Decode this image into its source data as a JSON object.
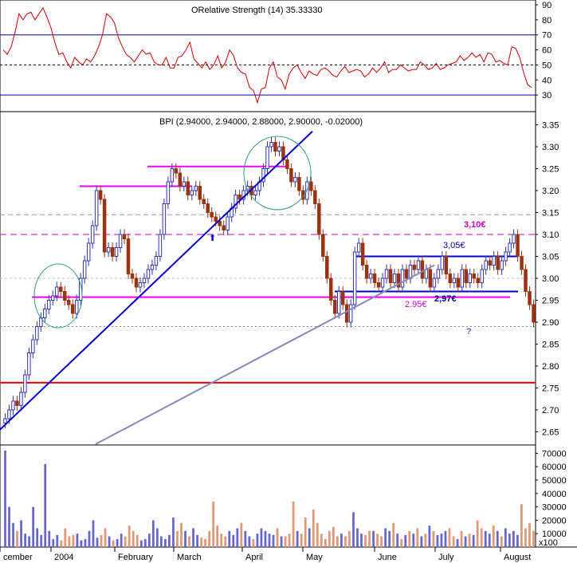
{
  "chart_data": [
    {
      "panel": "rsi",
      "type": "line",
      "title": "ORelative Strength (14) 35.33330",
      "ylim": [
        20,
        90
      ],
      "y_ticks": [
        90,
        80,
        70,
        60,
        50,
        40,
        30
      ],
      "reference_lines": [
        70,
        50,
        30
      ],
      "color": "#cc0000",
      "values": [
        60,
        57,
        62,
        72,
        84,
        80,
        84,
        85,
        80,
        84,
        88,
        82,
        75,
        65,
        57,
        58,
        52,
        48,
        55,
        52,
        50,
        54,
        52,
        56,
        62,
        70,
        84,
        82,
        78,
        68,
        62,
        57,
        55,
        52,
        56,
        60,
        57,
        58,
        52,
        50,
        50,
        55,
        48,
        48,
        55,
        56,
        60,
        65,
        54,
        51,
        48,
        52,
        47,
        50,
        56,
        48,
        52,
        60,
        56,
        48,
        45,
        44,
        35,
        33,
        25,
        34,
        35,
        48,
        52,
        42,
        40,
        34,
        44,
        48,
        50,
        45,
        41,
        46,
        44,
        43,
        47,
        48,
        46,
        43,
        42,
        46,
        49,
        45,
        46,
        47,
        46,
        42,
        44,
        48,
        45,
        48,
        52,
        45,
        47,
        47,
        50,
        48,
        46,
        47,
        47,
        52,
        50,
        47,
        48,
        51,
        47,
        48,
        50,
        51,
        52,
        56,
        53,
        55,
        58,
        55,
        57,
        52,
        58,
        57,
        52,
        53,
        51,
        50,
        62,
        61,
        55,
        45,
        37,
        35
      ]
    },
    {
      "panel": "price",
      "type": "ohlc",
      "title": "BPI (2.94000, 2.94000, 2.88000, 2.90000, -0.02000)",
      "ylim": [
        2.62,
        3.38
      ],
      "y_ticks": [
        "3.35",
        "3.30",
        "3.25",
        "3.20",
        "3.15",
        "3.10",
        "3.05",
        "3.00",
        "2.95",
        "2.90",
        "2.85",
        "2.80",
        "2.75",
        "2.70",
        "2.65"
      ],
      "x_labels": [
        "cember",
        "2004",
        "February",
        "March",
        "April",
        "May",
        "June",
        "July",
        "August"
      ],
      "up_color": "#3333aa",
      "down_color": "#993311",
      "close": [
        2.68,
        2.7,
        2.72,
        2.71,
        2.74,
        2.78,
        2.83,
        2.86,
        2.89,
        2.91,
        2.93,
        2.95,
        2.96,
        2.98,
        2.97,
        2.95,
        2.94,
        2.92,
        2.95,
        3.0,
        3.04,
        3.08,
        3.12,
        3.2,
        3.18,
        3.06,
        3.07,
        3.05,
        3.07,
        3.1,
        3.09,
        3.01,
        3.0,
        2.98,
        2.99,
        3.0,
        3.02,
        3.03,
        3.05,
        3.1,
        3.17,
        3.22,
        3.25,
        3.24,
        3.21,
        3.22,
        3.19,
        3.2,
        3.21,
        3.18,
        3.17,
        3.15,
        3.14,
        3.13,
        3.12,
        3.11,
        3.14,
        3.16,
        3.19,
        3.18,
        3.2,
        3.21,
        3.19,
        3.2,
        3.22,
        3.25,
        3.3,
        3.31,
        3.29,
        3.3,
        3.27,
        3.25,
        3.22,
        3.23,
        3.2,
        3.18,
        3.22,
        3.2,
        3.17,
        3.1,
        3.05,
        3.0,
        2.95,
        2.92,
        2.97,
        2.94,
        2.9,
        2.94,
        3.06,
        3.08,
        3.03,
        3.0,
        3.01,
        2.99,
        2.98,
        3.0,
        3.02,
        2.99,
        3.01,
        2.98,
        3.02,
        3.0,
        3.03,
        3.02,
        3.04,
        3.0,
        3.02,
        2.98,
        3.0,
        3.02,
        3.05,
        3.01,
        2.99,
        3.0,
        2.98,
        3.02,
        2.99,
        3.01,
        3.0,
        2.99,
        3.02,
        3.04,
        3.03,
        3.05,
        3.02,
        3.04,
        3.06,
        3.08,
        3.1,
        3.05,
        3.02,
        2.97,
        2.94,
        2.9
      ]
    },
    {
      "panel": "volume",
      "type": "bar",
      "ylim": [
        0,
        75000
      ],
      "y_ticks": [
        "70000",
        "60000",
        "50000",
        "40000",
        "30000",
        "20000",
        "10000"
      ],
      "unit_label": "x100",
      "up_color": "#6666cc",
      "down_color": "#dd9977",
      "values": [
        72000,
        30000,
        18000,
        12000,
        20000,
        10000,
        8000,
        30000,
        14000,
        9000,
        62000,
        12000,
        6000,
        9000,
        5000,
        14000,
        8000,
        9000,
        10000,
        5000,
        6000,
        12000,
        20000,
        7000,
        9000,
        14000,
        8000,
        5000,
        6000,
        10000,
        8000,
        16000,
        12000,
        9000,
        5000,
        6000,
        10000,
        20000,
        14000,
        8000,
        6000,
        9000,
        22000,
        12000,
        18000,
        12000,
        8000,
        14000,
        9000,
        7000,
        6000,
        12000,
        34000,
        16000,
        10000,
        8000,
        12000,
        9000,
        14000,
        18000,
        12000,
        8000,
        6000,
        10000,
        14000,
        12000,
        10000,
        9000,
        14000,
        8000,
        8000,
        10000,
        34000,
        12000,
        10000,
        22000,
        14000,
        28000,
        18000,
        10000,
        6000,
        12000,
        15000,
        8000,
        10000,
        8000,
        12000,
        26000,
        14000,
        10000,
        9000,
        12000,
        12000,
        10000,
        8000,
        14000,
        12000,
        18000,
        10000,
        6000,
        9000,
        12000,
        10000,
        14000,
        8000,
        10000,
        16000,
        12000,
        9000,
        10000,
        12000,
        14000,
        8000,
        6000,
        12000,
        8000,
        10000,
        9000,
        20000,
        14000,
        12000,
        10000,
        16000,
        12000,
        8000,
        14000,
        10000,
        12000,
        9000,
        32000,
        14000,
        18000,
        12000
      ]
    }
  ],
  "annotations": {
    "price_310": "3,10€",
    "price_305": "3,05€",
    "price_297": "2,97€",
    "price_295": "2.95€",
    "question": "?",
    "arrow_up": "⬆"
  }
}
